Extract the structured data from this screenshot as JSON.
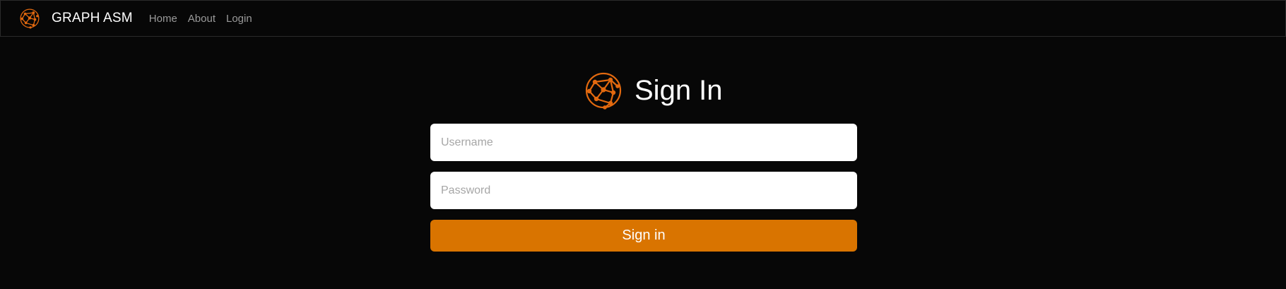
{
  "navbar": {
    "brand": {
      "logo_icon": "graph-network-icon",
      "title": "GRAPH ASM"
    },
    "links": [
      {
        "label": "Home"
      },
      {
        "label": "About"
      },
      {
        "label": "Login"
      }
    ]
  },
  "signin": {
    "logo_icon": "graph-network-icon",
    "title": "Sign In",
    "username": {
      "placeholder": "Username",
      "value": ""
    },
    "password": {
      "placeholder": "Password",
      "value": ""
    },
    "submit_label": "Sign in"
  },
  "colors": {
    "background": "#070707",
    "accent": "#d97400",
    "nav_link": "#9a9a9a",
    "text": "#ffffff"
  }
}
